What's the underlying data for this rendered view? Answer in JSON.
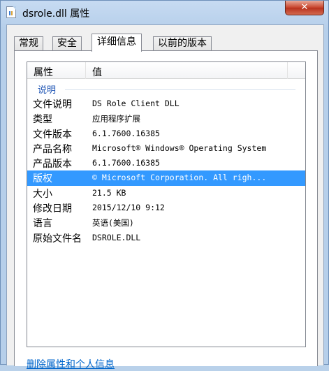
{
  "window": {
    "title": "dsrole.dll 属性",
    "close_glyph": "✕"
  },
  "tabs": [
    {
      "label": "常规",
      "active": false
    },
    {
      "label": "安全",
      "active": false
    },
    {
      "label": "详细信息",
      "active": true
    },
    {
      "label": "以前的版本",
      "active": false
    }
  ],
  "details": {
    "header": {
      "property": "属性",
      "value": "值"
    },
    "group": "说明",
    "rows": [
      {
        "name": "文件说明",
        "value": "DS Role Client DLL"
      },
      {
        "name": "类型",
        "value": "应用程序扩展"
      },
      {
        "name": "文件版本",
        "value": "6.1.7600.16385"
      },
      {
        "name": "产品名称",
        "value": "Microsoft® Windows® Operating System"
      },
      {
        "name": "产品版本",
        "value": "6.1.7600.16385"
      },
      {
        "name": "版权",
        "value": "© Microsoft Corporation. All righ...",
        "selected": true
      },
      {
        "name": "大小",
        "value": "21.5 KB"
      },
      {
        "name": "修改日期",
        "value": "2015/12/10 9:12"
      },
      {
        "name": "语言",
        "value": "英语(美国)"
      },
      {
        "name": "原始文件名",
        "value": "DSROLE.DLL"
      }
    ]
  },
  "footer": {
    "remove_link": "删除属性和个人信息"
  },
  "colors": {
    "selection": "#3399ff",
    "link": "#0066cc",
    "group": "#1e54b4",
    "close": "#c7432b"
  }
}
